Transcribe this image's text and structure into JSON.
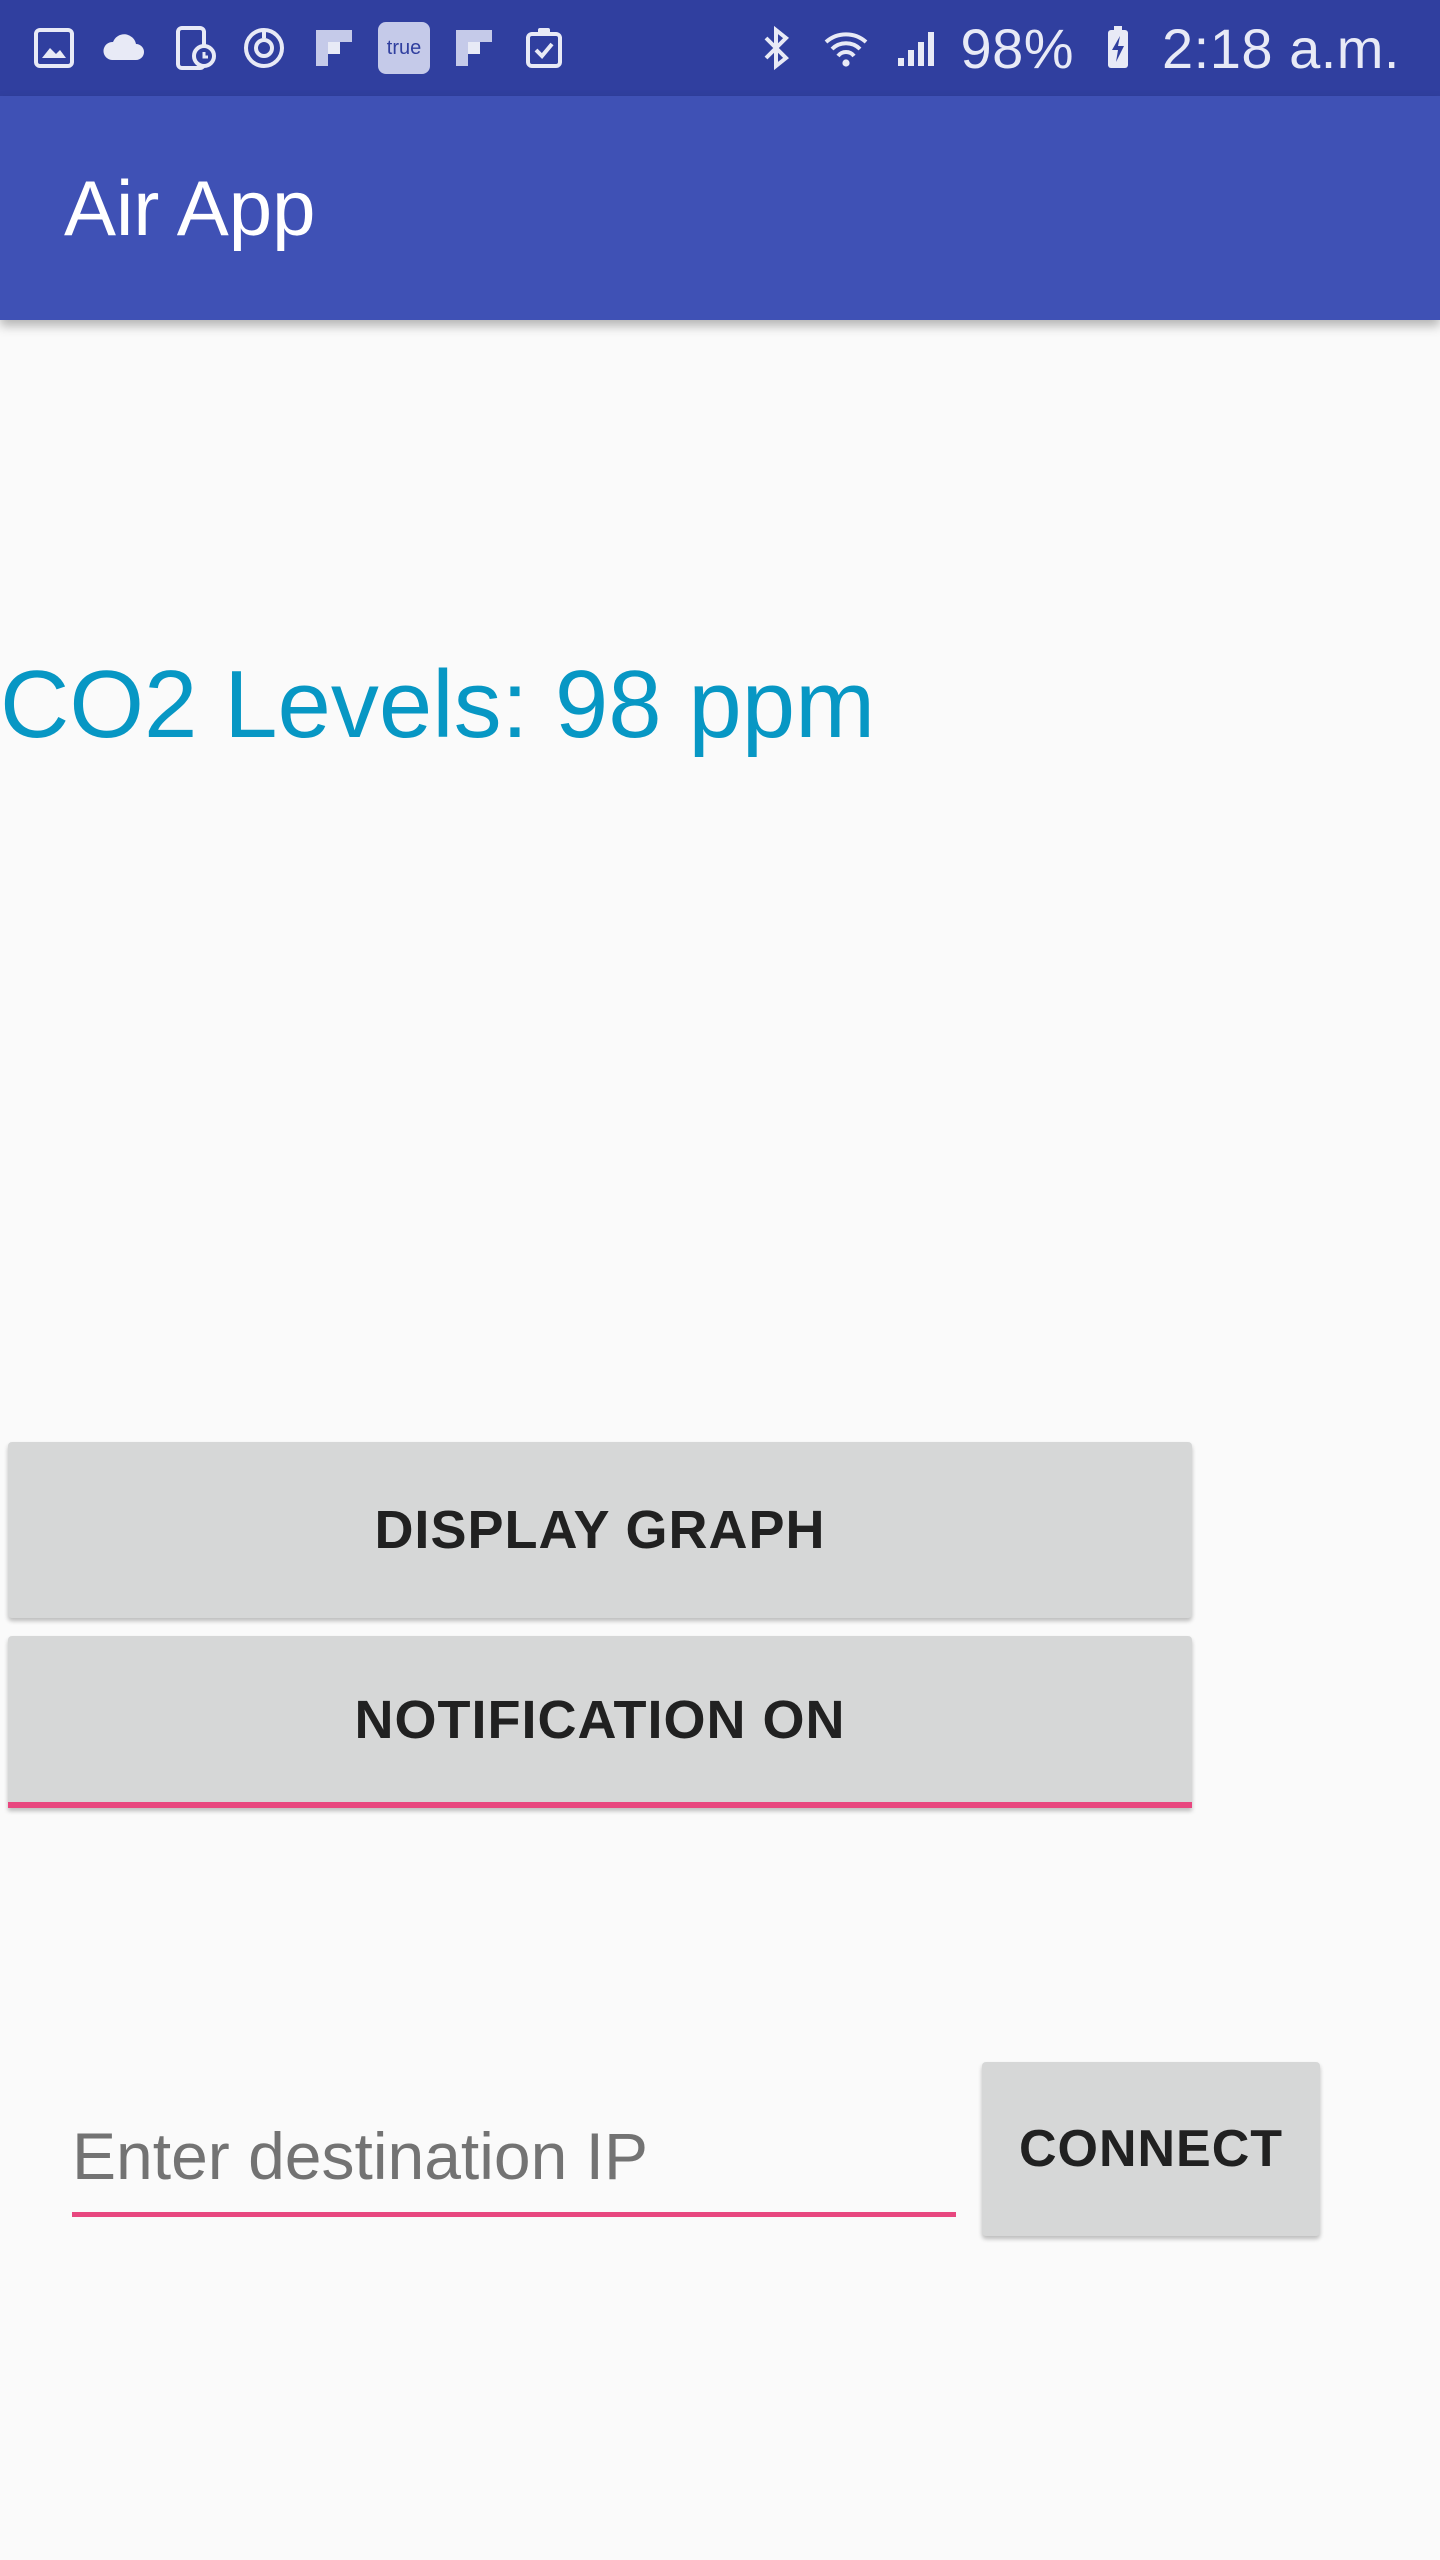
{
  "status_bar": {
    "left_icons": [
      "gallery-icon",
      "cloud-icon",
      "tablet-clock-icon",
      "sync-icon",
      "flipboard-icon",
      "true-app-icon",
      "flipboard-icon",
      "clipboard-check-icon"
    ],
    "true_badge_label": "true",
    "right_icons": [
      "bluetooth-icon",
      "wifi-icon",
      "cell-signal-icon",
      "battery-charging-icon"
    ],
    "battery": "98%",
    "time": "2:18 a.m."
  },
  "app_bar": {
    "title": "Air App",
    "color": "#3f51b5"
  },
  "reading": {
    "text": "CO2 Levels: 98 ppm",
    "color": "#0797c4"
  },
  "buttons": {
    "display_graph": "DISPLAY GRAPH",
    "notification": "NOTIFICATION ON",
    "connect": "CONNECT"
  },
  "ip_input": {
    "placeholder": "Enter destination IP",
    "value": ""
  },
  "accent_color": "#e8477f"
}
